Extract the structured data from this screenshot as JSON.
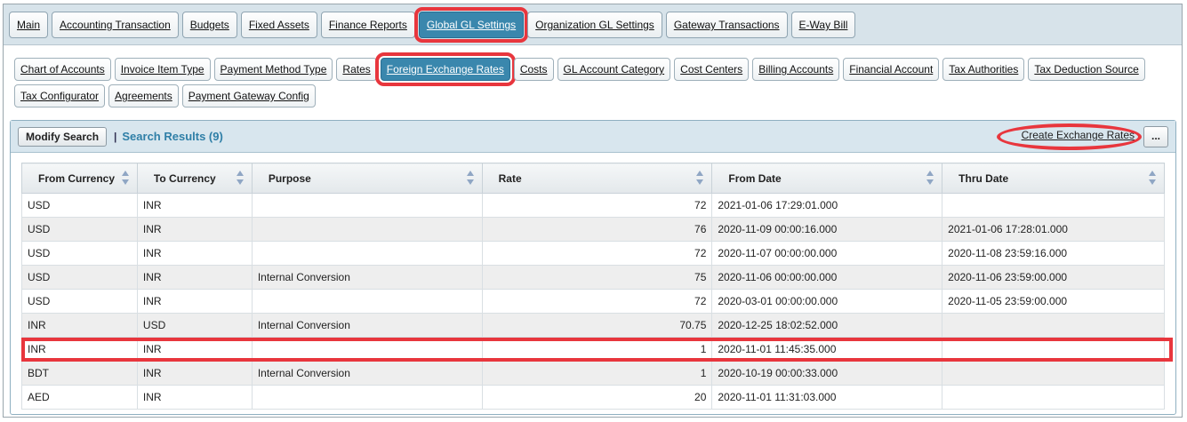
{
  "tabs": [
    {
      "label": "Main",
      "active": false
    },
    {
      "label": "Accounting Transaction",
      "active": false
    },
    {
      "label": "Budgets",
      "active": false
    },
    {
      "label": "Fixed Assets",
      "active": false
    },
    {
      "label": "Finance Reports",
      "active": false
    },
    {
      "label": "Global GL Settings",
      "active": true
    },
    {
      "label": "Organization GL Settings",
      "active": false
    },
    {
      "label": "Gateway Transactions",
      "active": false
    },
    {
      "label": "E-Way Bill",
      "active": false
    }
  ],
  "subtabs": [
    {
      "label": "Chart of Accounts",
      "active": false
    },
    {
      "label": "Invoice Item Type",
      "active": false
    },
    {
      "label": "Payment Method Type",
      "active": false
    },
    {
      "label": "Rates",
      "active": false
    },
    {
      "label": "Foreign Exchange Rates",
      "active": true
    },
    {
      "label": "Costs",
      "active": false
    },
    {
      "label": "GL Account Category",
      "active": false
    },
    {
      "label": "Cost Centers",
      "active": false
    },
    {
      "label": "Billing Accounts",
      "active": false
    },
    {
      "label": "Financial Account",
      "active": false
    },
    {
      "label": "Tax Authorities",
      "active": false
    },
    {
      "label": "Tax Deduction Source",
      "active": false
    },
    {
      "label": "Tax Configurator",
      "active": false
    },
    {
      "label": "Agreements",
      "active": false
    },
    {
      "label": "Payment Gateway Config",
      "active": false
    }
  ],
  "panel": {
    "modify_search_label": "Modify Search",
    "separator": "|",
    "results_title": "Search Results (9)",
    "create_link_label": "Create Exchange Rates",
    "more_label": "..."
  },
  "table": {
    "columns": [
      "From Currency",
      "To Currency",
      "Purpose",
      "Rate",
      "From Date",
      "Thru Date"
    ],
    "rows": [
      [
        "USD",
        "INR",
        "",
        "72",
        "2021-01-06 17:29:01.000",
        ""
      ],
      [
        "USD",
        "INR",
        "",
        "76",
        "2020-11-09 00:00:16.000",
        "2021-01-06 17:28:01.000"
      ],
      [
        "USD",
        "INR",
        "",
        "72",
        "2020-11-07 00:00:00.000",
        "2020-11-08 23:59:16.000"
      ],
      [
        "USD",
        "INR",
        "Internal Conversion",
        "75",
        "2020-11-06 00:00:00.000",
        "2020-11-06 23:59:00.000"
      ],
      [
        "USD",
        "INR",
        "",
        "72",
        "2020-03-01 00:00:00.000",
        "2020-11-05 23:59:00.000"
      ],
      [
        "INR",
        "USD",
        "Internal Conversion",
        "70.75",
        "2020-12-25 18:02:52.000",
        ""
      ],
      [
        "INR",
        "INR",
        "",
        "1",
        "2020-11-01 11:45:35.000",
        ""
      ],
      [
        "BDT",
        "INR",
        "Internal Conversion",
        "1",
        "2020-10-19 00:00:33.000",
        ""
      ],
      [
        "AED",
        "INR",
        "",
        "20",
        "2020-11-01 11:31:03.000",
        ""
      ]
    ]
  },
  "colors": {
    "accent": "#3a87ad",
    "highlight": "#e8363d",
    "results_title": "#2f7fa7"
  }
}
